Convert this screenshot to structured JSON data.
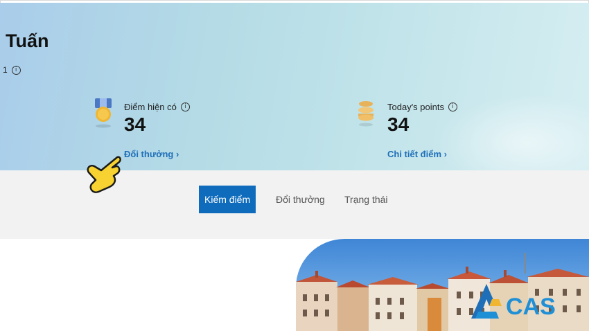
{
  "user": {
    "name": "Tuấn",
    "level": "1"
  },
  "cards": [
    {
      "label": "Điểm hiện có",
      "value": "34",
      "link": "Đổi thưởng",
      "icon": "medal-icon"
    },
    {
      "label": "Today's points",
      "value": "34",
      "link": "Chi tiết điểm",
      "icon": "coin-stack-icon"
    }
  ],
  "tabs": [
    {
      "label": "Kiếm điểm",
      "active": true
    },
    {
      "label": "Đổi thưởng",
      "active": false
    },
    {
      "label": "Trạng thái",
      "active": false
    }
  ],
  "watermark": {
    "text": "CAS"
  },
  "colors": {
    "accent": "#0f6cbd",
    "link": "#1f6fb8",
    "hero_start": "#a9cdea",
    "hero_end": "#d6eef2",
    "tab_bar": "#f2f2f2"
  }
}
